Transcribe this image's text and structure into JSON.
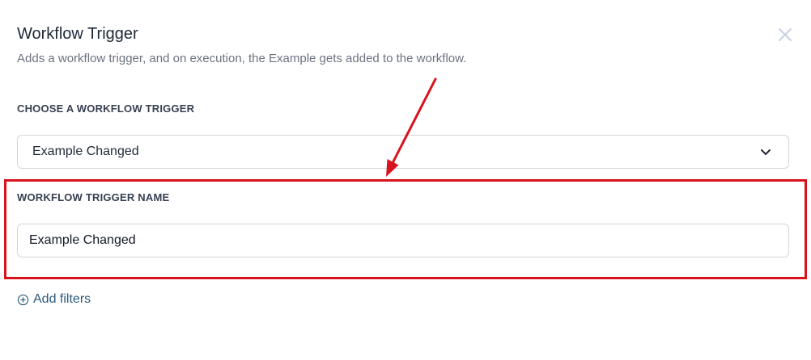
{
  "header": {
    "title": "Workflow Trigger",
    "subtitle": "Adds a workflow trigger, and on execution, the Example gets added to the workflow."
  },
  "trigger_select": {
    "label": "CHOOSE A WORKFLOW TRIGGER",
    "value": "Example Changed"
  },
  "trigger_name": {
    "label": "WORKFLOW TRIGGER NAME",
    "value": "Example Changed"
  },
  "filters": {
    "add_label": "Add filters"
  },
  "icons": {
    "close": "close-icon",
    "chevron": "chevron-down-icon",
    "add": "plus-circle-icon"
  },
  "colors": {
    "annotation": "#d8131c",
    "link": "#2c5a7c",
    "close_icon": "#c7d2e0"
  }
}
